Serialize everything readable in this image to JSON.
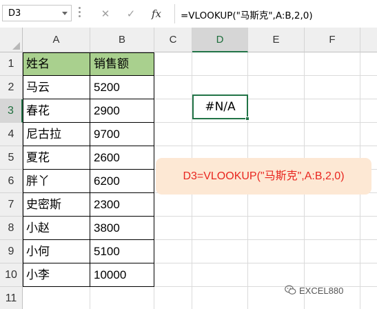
{
  "formula_bar": {
    "name_box": "D3",
    "cancel_glyph": "✕",
    "enter_glyph": "✓",
    "fx_label": "fx",
    "formula": "=VLOOKUP(\"马斯克\",A:B,2,0)"
  },
  "columns": [
    "A",
    "B",
    "C",
    "D",
    "E",
    "F"
  ],
  "rows": [
    "1",
    "2",
    "3",
    "4",
    "5",
    "6",
    "7",
    "8",
    "9",
    "10",
    "11"
  ],
  "table": {
    "header": [
      "姓名",
      "销售额"
    ],
    "rows": [
      [
        "马云",
        "5200"
      ],
      [
        "春花",
        "2900"
      ],
      [
        "尼古拉",
        "9700"
      ],
      [
        "夏花",
        "2600"
      ],
      [
        "胖丫",
        "6200"
      ],
      [
        "史密斯",
        "2300"
      ],
      [
        "小赵",
        "3800"
      ],
      [
        "小何",
        "5100"
      ],
      [
        "小李",
        "10000"
      ]
    ],
    "header_color": "#a9d08e"
  },
  "active_cell": {
    "ref": "D3",
    "value": "#N/A"
  },
  "annotation": {
    "text": "D3=VLOOKUP(\"马斯克\",A:B,2,0)",
    "text_color": "#e8261f",
    "background": "#fde8d4"
  },
  "watermark": {
    "text": "EXCEL880",
    "icon": "wechat-icon"
  },
  "colors": {
    "accent": "#217346"
  }
}
